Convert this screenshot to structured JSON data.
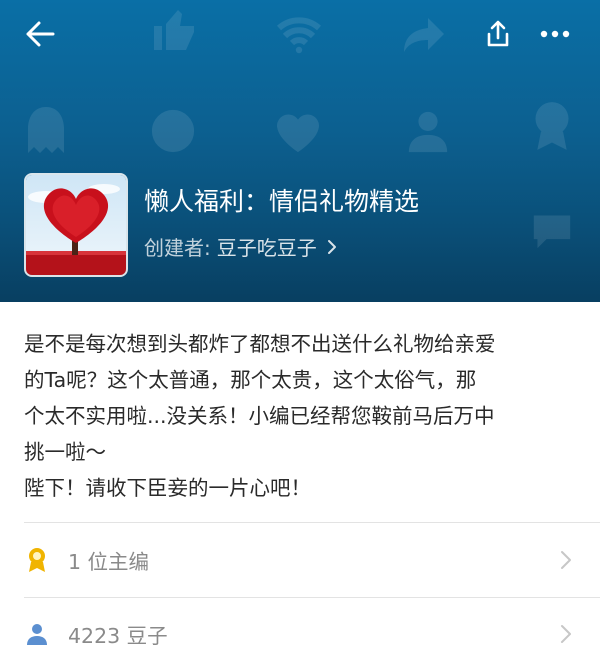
{
  "header": {
    "background_color": "#0c5f8f",
    "back_icon": "back-arrow-icon",
    "share_icon": "share-icon",
    "more_icon": "more-icon",
    "title": "懒人福利：情侣礼物精选",
    "creator_label": "创建者:",
    "creator_name": "豆子吃豆子"
  },
  "description": {
    "lines": [
      "是不是每次想到头都炸了都想不出送什么礼物给亲爱",
      "的Ta呢？这个太普通，那个太贵，这个太俗气，那",
      "个太不实用啦...没关系！小编已经帮您鞍前马后万中",
      "挑一啦～",
      "陛下！请收下臣妾的一片心吧！"
    ]
  },
  "rows": [
    {
      "icon": "medal-icon",
      "label": "1 位主编",
      "icon_color": "#f0b400"
    },
    {
      "icon": "user-icon",
      "label": "4223 豆子",
      "icon_color": "#5b8fd0"
    }
  ]
}
